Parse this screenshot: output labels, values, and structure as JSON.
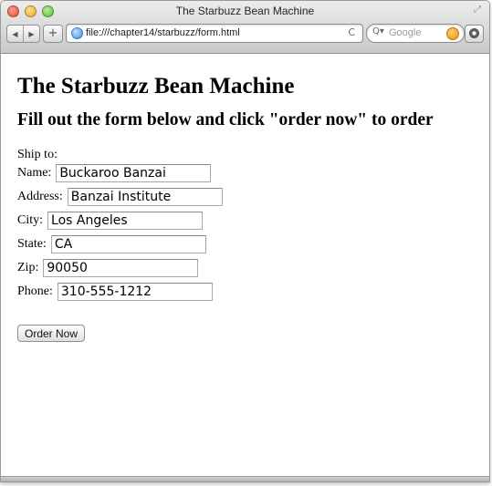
{
  "window": {
    "title": "The Starbuzz Bean Machine"
  },
  "toolbar": {
    "back_icon": "◀",
    "forward_icon": "▶",
    "add_icon": "+",
    "url": "file:///chapter14/starbuzz/form.html",
    "reload_icon": "C",
    "search_placeholder": "Google",
    "search_icon": "Q▾"
  },
  "page": {
    "heading": "The Starbuzz Bean Machine",
    "subheading": "Fill out the form below and click \"order now\" to order"
  },
  "form": {
    "ship_to_label": "Ship to:",
    "fields": {
      "name": {
        "label": "Name:",
        "value": "Buckaroo Banzai"
      },
      "address": {
        "label": "Address:",
        "value": "Banzai Institute"
      },
      "city": {
        "label": "City:",
        "value": "Los Angeles"
      },
      "state": {
        "label": "State:",
        "value": "CA"
      },
      "zip": {
        "label": "Zip:",
        "value": "90050"
      },
      "phone": {
        "label": "Phone:",
        "value": "310-555-1212"
      }
    },
    "submit_label": "Order Now"
  }
}
